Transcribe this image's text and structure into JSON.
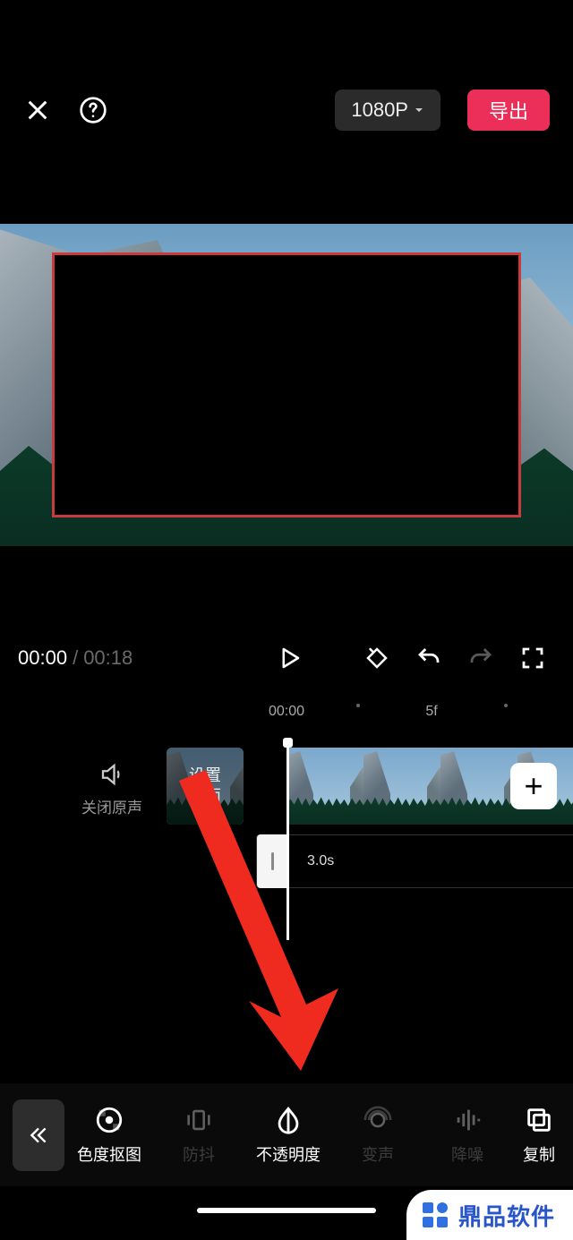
{
  "header": {
    "resolution": "1080P",
    "export": "导出"
  },
  "time": {
    "current": "00:00",
    "separator": "/",
    "total": "00:18"
  },
  "ruler": {
    "marks": [
      "00:00",
      "5f"
    ]
  },
  "tracks": {
    "mute_label": "关闭原声",
    "cover_label": "设置\n封面",
    "overlay_duration": "3.0s"
  },
  "toolbar": {
    "items": [
      {
        "key": "chroma",
        "label": "色度抠图",
        "active": true
      },
      {
        "key": "stabilize",
        "label": "防抖",
        "active": false
      },
      {
        "key": "opacity",
        "label": "不透明度",
        "active": true
      },
      {
        "key": "voice",
        "label": "变声",
        "active": false
      },
      {
        "key": "denoise",
        "label": "降噪",
        "active": false
      },
      {
        "key": "copy",
        "label": "复制",
        "active": true
      }
    ]
  },
  "watermark": "鼎品软件"
}
